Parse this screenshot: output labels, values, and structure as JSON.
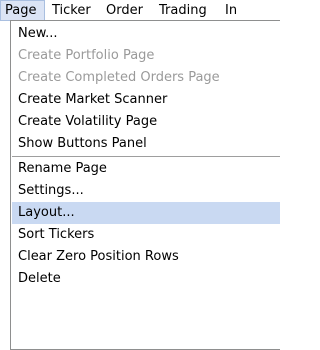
{
  "menubar": {
    "items": [
      {
        "label": "Page"
      },
      {
        "label": "Ticker"
      },
      {
        "label": "Order"
      },
      {
        "label": "Trading"
      },
      {
        "label": "In"
      }
    ]
  },
  "menu": {
    "items": [
      {
        "label": "New...",
        "enabled": true
      },
      {
        "label": "Create Portfolio Page",
        "enabled": false
      },
      {
        "label": "Create Completed Orders Page",
        "enabled": false
      },
      {
        "label": "Create Market Scanner",
        "enabled": true
      },
      {
        "label": "Create Volatility Page",
        "enabled": true
      },
      {
        "label": "Show Buttons Panel",
        "enabled": true
      },
      {
        "label": "Rename Page",
        "enabled": true
      },
      {
        "label": "Settings...",
        "enabled": true
      },
      {
        "label": "Layout...",
        "enabled": true,
        "highlighted": true
      },
      {
        "label": "Sort Tickers",
        "enabled": true
      },
      {
        "label": "Clear Zero Position Rows",
        "enabled": true
      },
      {
        "label": "Delete",
        "enabled": true
      }
    ]
  },
  "colors": {
    "active_menu_bg": "#dbe4f5",
    "highlight_bg": "#c9d9f2",
    "disabled_text": "#9a9a9a"
  }
}
